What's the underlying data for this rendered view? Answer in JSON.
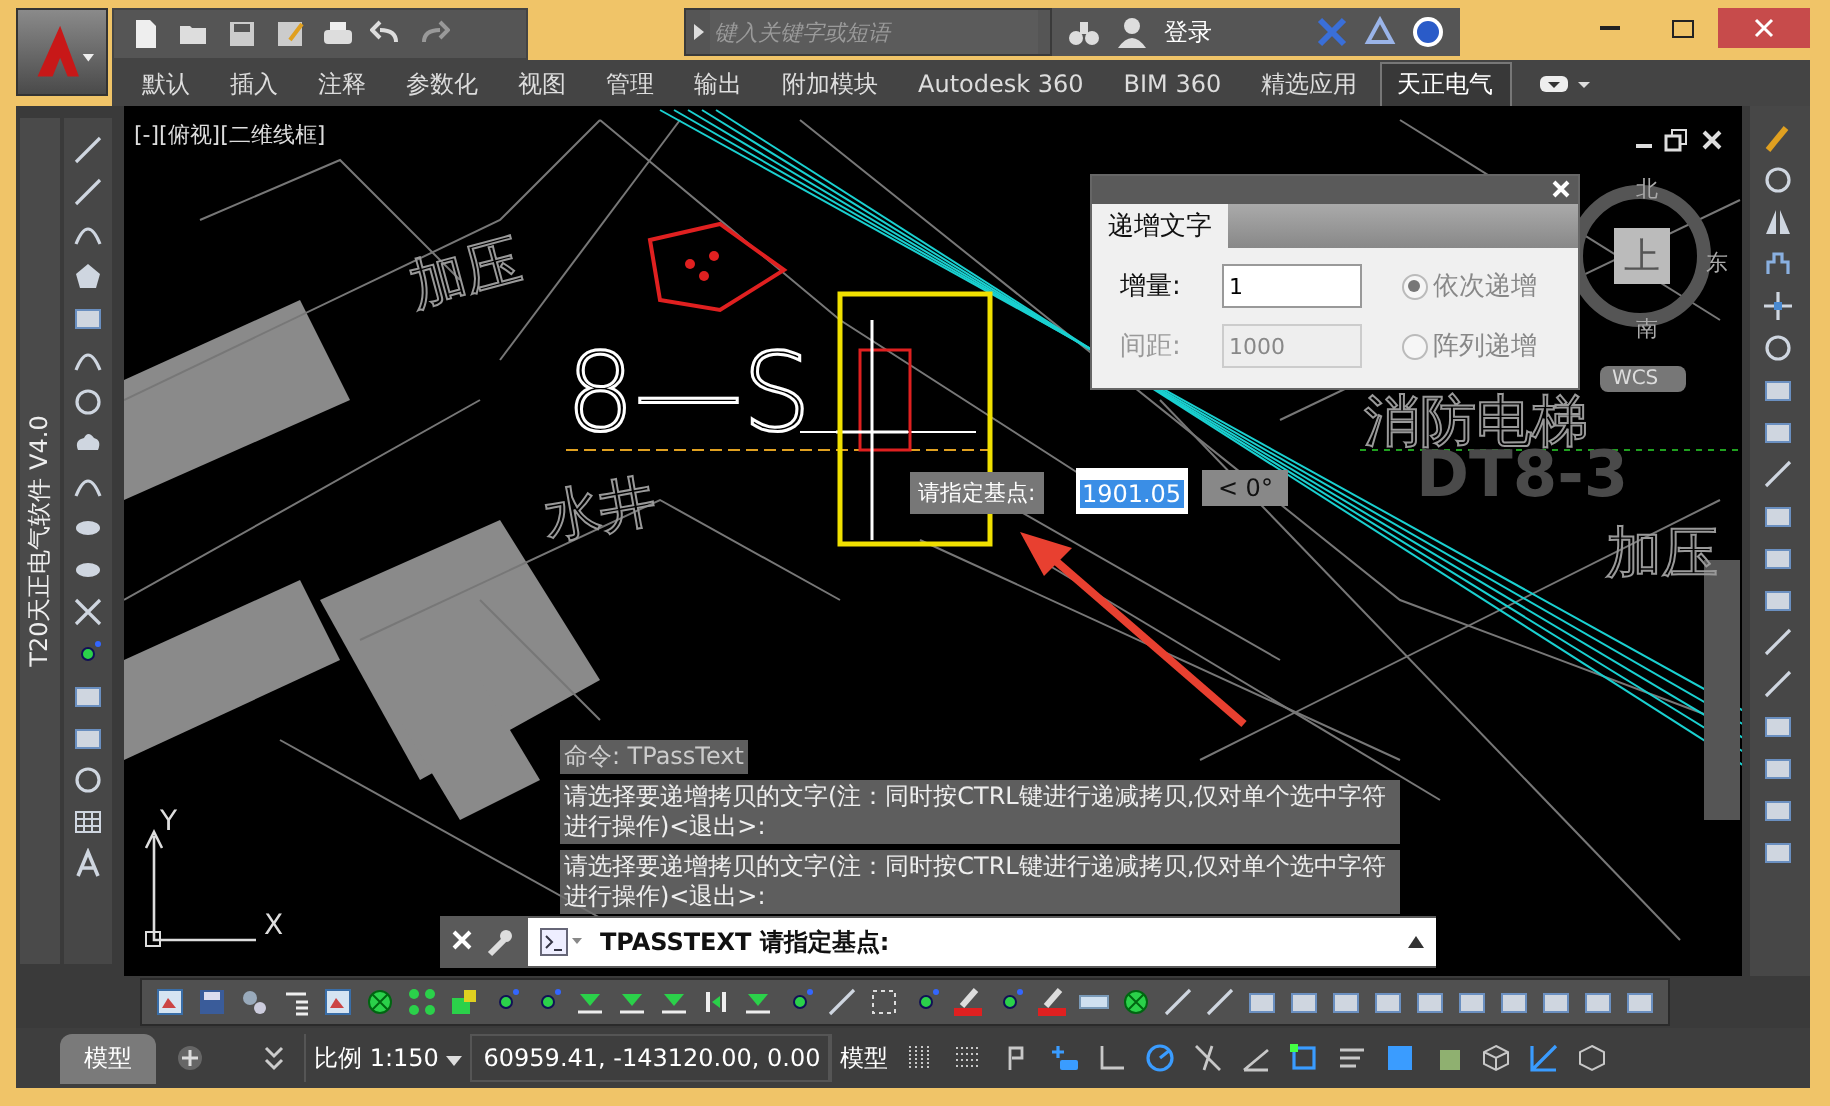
{
  "title_bar": {
    "search_placeholder": "键入关键字或短语",
    "login": "登录"
  },
  "ribbon_tabs": [
    {
      "label": "默认",
      "selected": false
    },
    {
      "label": "插入",
      "selected": false
    },
    {
      "label": "注释",
      "selected": false
    },
    {
      "label": "参数化",
      "selected": false
    },
    {
      "label": "视图",
      "selected": false
    },
    {
      "label": "管理",
      "selected": false
    },
    {
      "label": "输出",
      "selected": false
    },
    {
      "label": "附加模块",
      "selected": false
    },
    {
      "label": "Autodesk 360",
      "selected": false
    },
    {
      "label": "BIM 360",
      "selected": false
    },
    {
      "label": "精选应用",
      "selected": false
    },
    {
      "label": "天正电气",
      "selected": true
    }
  ],
  "sidebar_label": "T20天正电气软件 V4.0",
  "viewport": {
    "label": "[-][俯视][二维线框]",
    "drawing_texts": [
      {
        "kind": "outline",
        "text": "加压"
      },
      {
        "kind": "white",
        "text": "8—S"
      },
      {
        "kind": "outline",
        "text": "水井"
      },
      {
        "kind": "outline",
        "text": "消防电梯"
      },
      {
        "kind": "bold",
        "text": "DT8-3"
      },
      {
        "kind": "outline",
        "text": "加压"
      }
    ],
    "viewcube": {
      "north": "北",
      "east": "东",
      "south": "南",
      "top": "上"
    },
    "wcs": "WCS",
    "ucs": {
      "x": "X",
      "y": "Y"
    }
  },
  "dialog": {
    "tab": "递增文字",
    "fields": [
      {
        "label": "增量:",
        "value": "1",
        "disabled": false
      },
      {
        "label": "间距:",
        "value": "1000",
        "disabled": true
      }
    ],
    "options": [
      {
        "label": "依次递增",
        "selected": true
      },
      {
        "label": "阵列递增",
        "selected": false
      }
    ]
  },
  "dynamic_input": {
    "prompt": "请指定基点:",
    "value": "1901.05",
    "angle": "< 0°"
  },
  "command_history": [
    "命令: TPassText",
    "请选择要递增拷贝的文字(注：同时按CTRL键进行递减拷贝,仅对单个选中字符进行操作)<退出>:",
    "请选择要递增拷贝的文字(注：同时按CTRL键进行递减拷贝,仅对单个选中字符进行操作)<退出>:"
  ],
  "command_line": {
    "value": "TPASSTEXT 请指定基点:"
  },
  "layout_tabs": [
    {
      "label": "模型",
      "selected": true
    }
  ],
  "status_bar": {
    "scale": "比例 1:150",
    "coordinates": "60959.41, -143120.00, 0.00",
    "space": "模型",
    "toggles": [
      {
        "kind": "grid",
        "on": false
      },
      {
        "kind": "snap",
        "on": false
      },
      {
        "kind": "infer",
        "on": false
      },
      {
        "kind": "dynamic",
        "on": true
      },
      {
        "kind": "ortho",
        "on": false
      },
      {
        "kind": "polar",
        "on": true
      },
      {
        "kind": "isometric",
        "on": false
      },
      {
        "kind": "tracking",
        "on": false
      },
      {
        "kind": "osnap",
        "on": true
      },
      {
        "kind": "lineweight",
        "on": false
      },
      {
        "kind": "transparency",
        "on": true
      },
      {
        "kind": "selection",
        "on": false
      },
      {
        "kind": "gizmo",
        "on": false
      },
      {
        "kind": "annotation",
        "on": true
      },
      {
        "kind": "workspace",
        "on": false
      }
    ]
  }
}
